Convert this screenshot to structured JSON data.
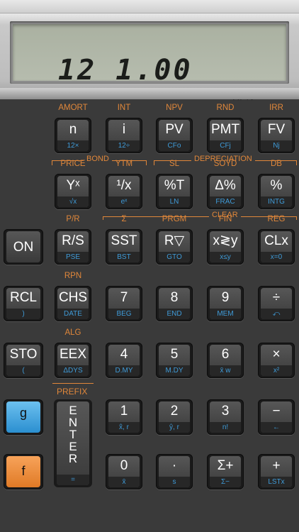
{
  "display": {
    "value": "12 1.00",
    "mode": "RPN"
  },
  "colors": {
    "orange_label": "#e0873a",
    "blue_label": "#3f9bd8",
    "g_key": "#2b8fd0",
    "f_key": "#e07a26"
  },
  "brackets": {
    "bond": "BOND",
    "depreciation": "DEPRECIATION",
    "clear": "CLEAR",
    "prefix": "PREFIX"
  },
  "rows": [
    [
      {
        "above": "AMORT",
        "main": "n",
        "sub": "12×"
      },
      {
        "above": "INT",
        "main": "i",
        "sub": "12÷"
      },
      {
        "above": "NPV",
        "main": "PV",
        "sub": "CFo"
      },
      {
        "above": "RND",
        "main": "PMT",
        "sub": "CFj"
      },
      {
        "above": "IRR",
        "main": "FV",
        "sub": "Nj"
      }
    ],
    [
      {
        "above": "PRICE",
        "main": "Yˣ",
        "sub": "√x"
      },
      {
        "above": "YTM",
        "main": "¹/x",
        "sub": "eˣ"
      },
      {
        "above": "SL",
        "main": "%T",
        "sub": "LN"
      },
      {
        "above": "SOYD",
        "main": "Δ%",
        "sub": "FRAC"
      },
      {
        "above": "DB",
        "main": "%",
        "sub": "INTG"
      }
    ],
    [
      {
        "above": "P/R",
        "main": "R/S",
        "sub": "PSE"
      },
      {
        "above": "Σ",
        "main": "SST",
        "sub": "BST"
      },
      {
        "above": "PRGM",
        "main": "R▽",
        "sub": "GTO"
      },
      {
        "above": "FIN",
        "main": "x≷y",
        "sub": "x≤y"
      },
      {
        "above": "REG",
        "main": "CLx",
        "sub": "x=0"
      }
    ],
    [
      {
        "above": "RPN",
        "main": "CHS",
        "sub": "DATE"
      },
      {
        "above": "",
        "main": "7",
        "sub": "BEG"
      },
      {
        "above": "",
        "main": "8",
        "sub": "END"
      },
      {
        "above": "",
        "main": "9",
        "sub": "MEM"
      },
      {
        "above": "",
        "main": "÷",
        "sub": "⤺"
      }
    ],
    [
      {
        "above": "ALG",
        "main": "EEX",
        "sub": "ΔDYS"
      },
      {
        "above": "",
        "main": "4",
        "sub": "D.MY"
      },
      {
        "above": "",
        "main": "5",
        "sub": "M.DY"
      },
      {
        "above": "",
        "main": "6",
        "sub": "x̄ w"
      },
      {
        "above": "",
        "main": "×",
        "sub": "x²"
      }
    ],
    [
      {
        "above": "",
        "main": "1",
        "sub": "x̂, r"
      },
      {
        "above": "",
        "main": "2",
        "sub": "ŷ, r"
      },
      {
        "above": "",
        "main": "3",
        "sub": "n!"
      },
      {
        "above": "",
        "main": "−",
        "sub": "←"
      }
    ],
    [
      {
        "above": "",
        "main": "0",
        "sub": "x̄"
      },
      {
        "above": "",
        "main": "·",
        "sub": "s"
      },
      {
        "above": "",
        "main": "Σ+",
        "sub": "Σ−"
      },
      {
        "above": "",
        "main": "+",
        "sub": "LSTx"
      }
    ]
  ],
  "left_keys": {
    "on": {
      "main": "ON"
    },
    "rcl": {
      "main": "RCL",
      "sub": ")"
    },
    "sto": {
      "main": "STO",
      "sub": "("
    },
    "g": {
      "main": "g"
    },
    "f": {
      "main": "f"
    }
  },
  "enter": {
    "letters": [
      "E",
      "N",
      "T",
      "E",
      "R"
    ],
    "sub": "="
  }
}
